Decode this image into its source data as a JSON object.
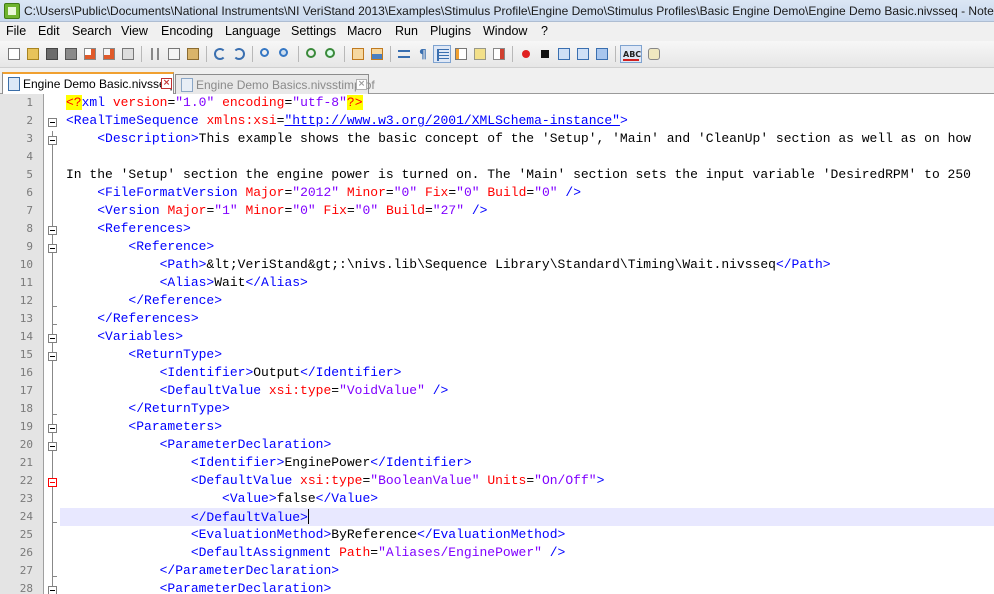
{
  "title": "C:\\Users\\Public\\Documents\\National Instruments\\NI VeriStand 2013\\Examples\\Stimulus Profile\\Engine Demo\\Stimulus Profiles\\Basic Engine Demo\\Engine Demo Basic.nivsseq - Notep",
  "menu": [
    "File",
    "Edit",
    "Search",
    "View",
    "Encoding",
    "Language",
    "Settings",
    "Macro",
    "Run",
    "Plugins",
    "Window",
    "?"
  ],
  "tabs": [
    {
      "label": "Engine Demo Basic.nivsseq",
      "active": true
    },
    {
      "label": "Engine Demo Basics.nivsstimprof",
      "active": false
    }
  ],
  "editor": {
    "line_numbers": [
      "1",
      "2",
      "3",
      "4",
      "5",
      "6",
      "7",
      "8",
      "9",
      "10",
      "11",
      "12",
      "13",
      "14",
      "15",
      "16",
      "17",
      "18",
      "19",
      "20",
      "21",
      "22",
      "23",
      "24",
      "25",
      "26",
      "27",
      "28"
    ],
    "current_line": 24,
    "lines": [
      [
        [
          "pi",
          "<?"
        ],
        [
          "tag",
          "xml "
        ],
        [
          "attr",
          "version"
        ],
        [
          "plain",
          "="
        ],
        [
          "val",
          "\"1.0\" "
        ],
        [
          "attr",
          "encoding"
        ],
        [
          "plain",
          "="
        ],
        [
          "val",
          "\"utf-8\""
        ],
        [
          "pi",
          "?>"
        ]
      ],
      [
        [
          "tag",
          "<RealTimeSequence "
        ],
        [
          "attr",
          "xmlns:xsi"
        ],
        [
          "plain",
          "="
        ],
        [
          "url",
          "\"http://www.w3.org/2001/XMLSchema-instance\""
        ],
        [
          "tag",
          ">"
        ]
      ],
      [
        [
          "plain",
          "    "
        ],
        [
          "tag",
          "<Description>"
        ],
        [
          "plain",
          "This example shows the basic concept of the 'Setup', 'Main' and 'CleanUp' section as well as on how"
        ]
      ],
      [
        [
          "plain",
          ""
        ]
      ],
      [
        [
          "plain",
          "In the 'Setup' section the engine power is turned on. The 'Main' section sets the input variable 'DesiredRPM' to 250"
        ]
      ],
      [
        [
          "plain",
          "    "
        ],
        [
          "tag",
          "<FileFormatVersion "
        ],
        [
          "attr",
          "Major"
        ],
        [
          "plain",
          "="
        ],
        [
          "val",
          "\"2012\" "
        ],
        [
          "attr",
          "Minor"
        ],
        [
          "plain",
          "="
        ],
        [
          "val",
          "\"0\" "
        ],
        [
          "attr",
          "Fix"
        ],
        [
          "plain",
          "="
        ],
        [
          "val",
          "\"0\" "
        ],
        [
          "attr",
          "Build"
        ],
        [
          "plain",
          "="
        ],
        [
          "val",
          "\"0\" "
        ],
        [
          "tag",
          "/>"
        ]
      ],
      [
        [
          "plain",
          "    "
        ],
        [
          "tag",
          "<Version "
        ],
        [
          "attr",
          "Major"
        ],
        [
          "plain",
          "="
        ],
        [
          "val",
          "\"1\" "
        ],
        [
          "attr",
          "Minor"
        ],
        [
          "plain",
          "="
        ],
        [
          "val",
          "\"0\" "
        ],
        [
          "attr",
          "Fix"
        ],
        [
          "plain",
          "="
        ],
        [
          "val",
          "\"0\" "
        ],
        [
          "attr",
          "Build"
        ],
        [
          "plain",
          "="
        ],
        [
          "val",
          "\"27\" "
        ],
        [
          "tag",
          "/>"
        ]
      ],
      [
        [
          "plain",
          "    "
        ],
        [
          "tag",
          "<References>"
        ]
      ],
      [
        [
          "plain",
          "        "
        ],
        [
          "tag",
          "<Reference>"
        ]
      ],
      [
        [
          "plain",
          "            "
        ],
        [
          "tag",
          "<Path>"
        ],
        [
          "plain",
          "&lt;VeriStand&gt;:\\nivs.lib\\Sequence Library\\Standard\\Timing\\Wait.nivsseq"
        ],
        [
          "tag",
          "</Path>"
        ]
      ],
      [
        [
          "plain",
          "            "
        ],
        [
          "tag",
          "<Alias>"
        ],
        [
          "plain",
          "Wait"
        ],
        [
          "tag",
          "</Alias>"
        ]
      ],
      [
        [
          "plain",
          "        "
        ],
        [
          "tag",
          "</Reference>"
        ]
      ],
      [
        [
          "plain",
          "    "
        ],
        [
          "tag",
          "</References>"
        ]
      ],
      [
        [
          "plain",
          "    "
        ],
        [
          "tag",
          "<Variables>"
        ]
      ],
      [
        [
          "plain",
          "        "
        ],
        [
          "tag",
          "<ReturnType>"
        ]
      ],
      [
        [
          "plain",
          "            "
        ],
        [
          "tag",
          "<Identifier>"
        ],
        [
          "plain",
          "Output"
        ],
        [
          "tag",
          "</Identifier>"
        ]
      ],
      [
        [
          "plain",
          "            "
        ],
        [
          "tag",
          "<DefaultValue "
        ],
        [
          "attr",
          "xsi:type"
        ],
        [
          "plain",
          "="
        ],
        [
          "val",
          "\"VoidValue\" "
        ],
        [
          "tag",
          "/>"
        ]
      ],
      [
        [
          "plain",
          "        "
        ],
        [
          "tag",
          "</ReturnType>"
        ]
      ],
      [
        [
          "plain",
          "        "
        ],
        [
          "tag",
          "<Parameters>"
        ]
      ],
      [
        [
          "plain",
          "            "
        ],
        [
          "tag",
          "<ParameterDeclaration>"
        ]
      ],
      [
        [
          "plain",
          "                "
        ],
        [
          "tag",
          "<Identifier>"
        ],
        [
          "plain",
          "EnginePower"
        ],
        [
          "tag",
          "</Identifier>"
        ]
      ],
      [
        [
          "plain",
          "                "
        ],
        [
          "tag",
          "<DefaultValue "
        ],
        [
          "attr",
          "xsi:type"
        ],
        [
          "plain",
          "="
        ],
        [
          "val",
          "\"BooleanValue\" "
        ],
        [
          "attr",
          "Units"
        ],
        [
          "plain",
          "="
        ],
        [
          "val",
          "\"On/Off\""
        ],
        [
          "tag",
          ">"
        ]
      ],
      [
        [
          "plain",
          "                    "
        ],
        [
          "tag",
          "<Value>"
        ],
        [
          "plain",
          "false"
        ],
        [
          "tag",
          "</Value>"
        ]
      ],
      [
        [
          "plain",
          "                "
        ],
        [
          "tag",
          "</DefaultValue>"
        ]
      ],
      [
        [
          "plain",
          "                "
        ],
        [
          "tag",
          "<EvaluationMethod>"
        ],
        [
          "plain",
          "ByReference"
        ],
        [
          "tag",
          "</EvaluationMethod>"
        ]
      ],
      [
        [
          "plain",
          "                "
        ],
        [
          "tag",
          "<DefaultAssignment "
        ],
        [
          "attr",
          "Path"
        ],
        [
          "plain",
          "="
        ],
        [
          "val",
          "\"Aliases/EnginePower\" "
        ],
        [
          "tag",
          "/>"
        ]
      ],
      [
        [
          "plain",
          "            "
        ],
        [
          "tag",
          "</ParameterDeclaration>"
        ]
      ],
      [
        [
          "plain",
          "            "
        ],
        [
          "tag",
          "<ParameterDeclaration>"
        ]
      ]
    ]
  },
  "icons": {
    "app": "notepad-plus-plus-icon",
    "tab_file": "document-icon",
    "tab_close": "close-icon"
  },
  "colors": {
    "tag": "#0000ff",
    "attr": "#ff0000",
    "value": "#8000ff",
    "current_line": "#e8e8ff",
    "processing_instruction_bg": "#ffff00"
  }
}
